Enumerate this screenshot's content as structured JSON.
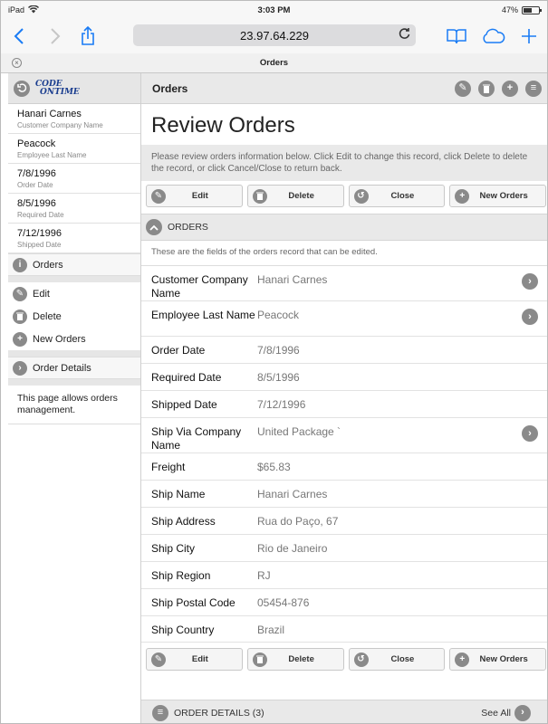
{
  "status": {
    "device": "iPad",
    "time": "3:03 PM",
    "battery": "47%",
    "battery_level": 0.47
  },
  "browser": {
    "url": "23.97.64.229",
    "tab_title": "Orders"
  },
  "sidebar": {
    "fields": [
      {
        "value": "Hanari Carnes",
        "label": "Customer Company Name"
      },
      {
        "value": "Peacock",
        "label": "Employee Last Name"
      },
      {
        "value": "7/8/1996",
        "label": "Order Date"
      },
      {
        "value": "8/5/1996",
        "label": "Required Date"
      },
      {
        "value": "7/12/1996",
        "label": "Shipped Date"
      }
    ],
    "current": "Orders",
    "actions": [
      "Edit",
      "Delete",
      "New Orders"
    ],
    "child": "Order Details",
    "note": "This page allows orders management.",
    "logo_line1": "CODE",
    "logo_line2": "ONTIME"
  },
  "main": {
    "header": "Orders",
    "page_title": "Review Orders",
    "description": "Please review orders information below. Click Edit to change this record, click Delete to delete the record, or click Cancel/Close to return back.",
    "buttons": [
      "Edit",
      "Delete",
      "Close",
      "New Orders"
    ],
    "section_title": "ORDERS",
    "section_description": "These are the fields of the orders record that can be edited.",
    "fields": [
      {
        "label": "Customer Company Name",
        "value": "Hanari Carnes"
      },
      {
        "label": "Employee Last Name",
        "value": "Peacock"
      },
      {
        "label": "Order Date",
        "value": "7/8/1996"
      },
      {
        "label": "Required Date",
        "value": "8/5/1996"
      },
      {
        "label": "Shipped Date",
        "value": "7/12/1996"
      },
      {
        "label": "Ship Via Company Name",
        "value": "United Package `"
      },
      {
        "label": "Freight",
        "value": "$65.83"
      },
      {
        "label": "Ship Name",
        "value": "Hanari Carnes"
      },
      {
        "label": "Ship Address",
        "value": "Rua do Paço, 67"
      },
      {
        "label": "Ship City",
        "value": "Rio de Janeiro"
      },
      {
        "label": "Ship Region",
        "value": "RJ"
      },
      {
        "label": "Ship Postal Code",
        "value": "05454-876"
      },
      {
        "label": "Ship Country",
        "value": "Brazil"
      }
    ],
    "details_title": "ORDER DETAILS (3)",
    "see_all": "See All"
  },
  "colors": {
    "accent": "#1a7cf5",
    "icon_gray": "#8a8a8a",
    "logo_blue": "#1a3d8f"
  }
}
